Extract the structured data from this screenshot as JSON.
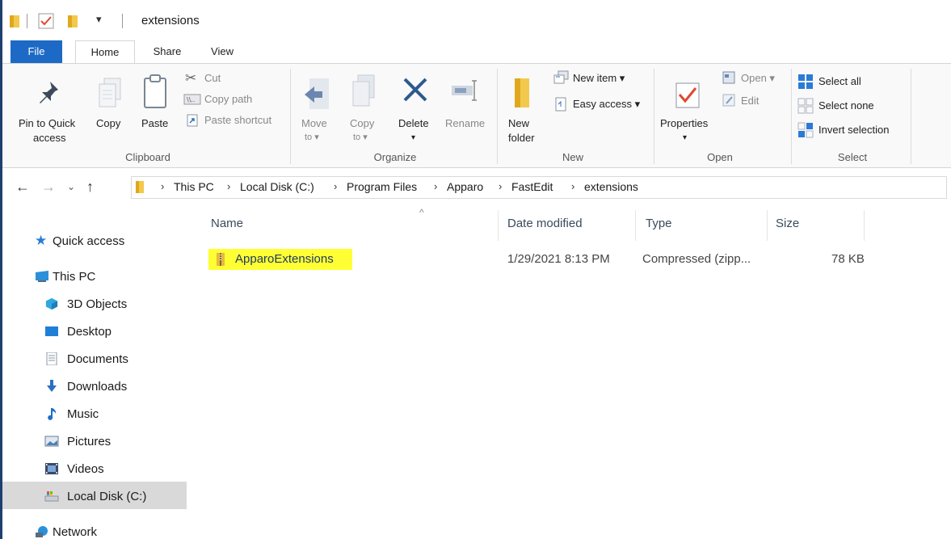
{
  "window": {
    "title": "extensions",
    "quick_access_toolbar_dropdown": "▾"
  },
  "tabs": [
    {
      "label": "File"
    },
    {
      "label": "Home"
    },
    {
      "label": "Share"
    },
    {
      "label": "View"
    }
  ],
  "ribbon": {
    "clipboard": {
      "pin_label_1": "Pin to Quick",
      "pin_label_2": "access",
      "copy": "Copy",
      "paste": "Paste",
      "cut": "Cut",
      "copy_path": "Copy path",
      "paste_shortcut": "Paste shortcut",
      "group": "Clipboard"
    },
    "organize": {
      "move_1": "Move",
      "move_2": "to ▾",
      "copy_1": "Copy",
      "copy_2": "to ▾",
      "delete": "Delete",
      "delete_arrow": "▾",
      "rename": "Rename",
      "group": "Organize"
    },
    "new": {
      "new_folder_1": "New",
      "new_folder_2": "folder",
      "new_item": "New item ▾",
      "easy_access": "Easy access ▾",
      "group": "New"
    },
    "open": {
      "properties": "Properties",
      "properties_arrow": "▾",
      "open": "Open ▾",
      "edit": "Edit",
      "group": "Open"
    },
    "select": {
      "select_all": "Select all",
      "select_none": "Select none",
      "invert_selection": "Invert selection",
      "group": "Select"
    }
  },
  "address": {
    "crumbs": [
      "This PC",
      "Local Disk (C:)",
      "Program Files",
      "Apparo",
      "FastEdit",
      "extensions"
    ]
  },
  "nav": {
    "items": [
      {
        "label": "Quick access",
        "icon": "star-icon"
      },
      {
        "label": "This PC",
        "icon": "computer-icon"
      },
      {
        "label": "3D Objects",
        "icon": "cube-icon"
      },
      {
        "label": "Desktop",
        "icon": "desktop-icon"
      },
      {
        "label": "Documents",
        "icon": "document-icon"
      },
      {
        "label": "Downloads",
        "icon": "download-icon"
      },
      {
        "label": "Music",
        "icon": "music-icon"
      },
      {
        "label": "Pictures",
        "icon": "pictures-icon"
      },
      {
        "label": "Videos",
        "icon": "videos-icon"
      },
      {
        "label": "Local Disk (C:)",
        "icon": "drive-icon",
        "selected": true
      },
      {
        "label": "Network",
        "icon": "network-icon"
      }
    ]
  },
  "filelist": {
    "columns": {
      "name": "Name",
      "date": "Date modified",
      "type": "Type",
      "size": "Size"
    },
    "sort_indicator": "^",
    "rows": [
      {
        "name": "ApparoExtensions",
        "date": "1/29/2021 8:13 PM",
        "type": "Compressed (zipp...",
        "size": "78 KB"
      }
    ]
  },
  "colors": {
    "file_tab": "#1c6ac5",
    "highlight": "#ffff33",
    "folder": "#f2c94c"
  }
}
